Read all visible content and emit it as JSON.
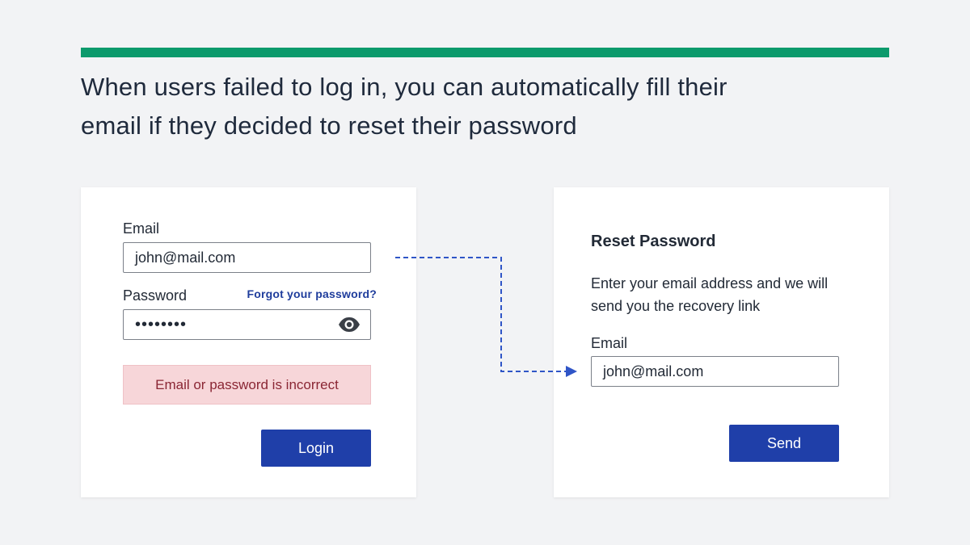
{
  "headline": {
    "line1": "When users failed to log in, you can automatically fill their",
    "line2": "email if they decided to reset their password"
  },
  "colors": {
    "accent_bar": "#0c9a6c",
    "primary_button": "#1f3fa9",
    "link": "#1f3d9c",
    "error_bg": "#f7d6d9",
    "error_text": "#8a2634",
    "connector": "#2f55c7"
  },
  "login_card": {
    "email_label": "Email",
    "email_value": "john@mail.com",
    "password_label": "Password",
    "forgot_link": "Forgot your password?",
    "password_masked": "••••••••",
    "show_password_icon": "eye-icon",
    "error_message": "Email or password is incorrect",
    "login_button": "Login"
  },
  "reset_card": {
    "title": "Reset Password",
    "desc_line1": "Enter your email address and we will",
    "desc_line2": "send you the recovery link",
    "email_label": "Email",
    "email_value": "john@mail.com",
    "send_button": "Send"
  }
}
